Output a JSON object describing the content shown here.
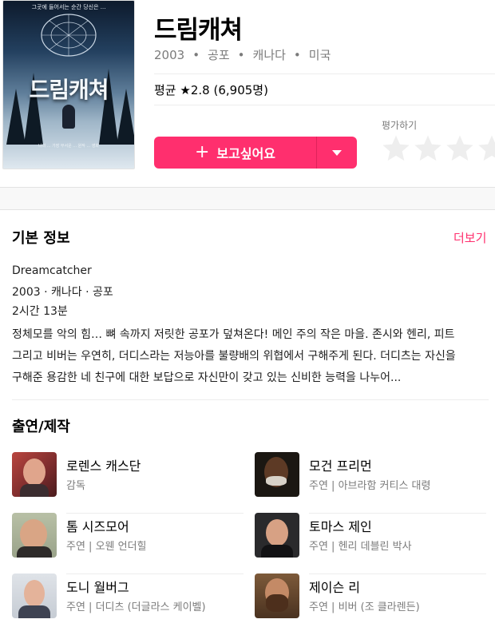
{
  "poster": {
    "tagline": "그곳에 들어서는 순간 당신은 ...",
    "title": "드림캐쳐",
    "credits": "나의 ... 가장 무서운 ... 원작 ... 영화"
  },
  "movie": {
    "title": "드림캐쳐",
    "year": "2003",
    "genre": "공포",
    "country1": "캐나다",
    "country2": "미국",
    "rating_prefix": "평균",
    "rating_value": "★2.8",
    "rating_count": "(6,905명)"
  },
  "actions": {
    "wish_plus": "+",
    "wish_label": "보고싶어요",
    "rate_label": "평가하기",
    "star_count": 4
  },
  "colors": {
    "accent": "#ff2f6e",
    "star_empty": "#eeeeee",
    "muted": "#7b7b7b"
  },
  "info": {
    "section_title": "기본 정보",
    "more_label": "더보기",
    "original_title": "Dreamcatcher",
    "summary_line": "2003 · 캐나다 · 공포",
    "runtime": "2시간 13분",
    "synopsis": "정체모를 악의 힘…  뼈 속까지 저릿한 공포가 덮쳐온다!  메인 주의 작은 마을. 존시와 헨리, 피트 그리고 비버는 우연히, 더디스라는 저능아를 불량배의 위협에서 구해주게 된다. 더디츠는 자신을 구해준 용감한 네 친구에 대한 보답으로 자신만이 갖고 있는 신비한 능력을 나누어..."
  },
  "cast": {
    "section_title": "출연/제작",
    "people": [
      {
        "name": "로렌스 캐스단",
        "role": "감독"
      },
      {
        "name": "모건 프리먼",
        "role": "주연 | 아브라함 커티스 대령"
      },
      {
        "name": "톰 시즈모어",
        "role": "주연 | 오웬 언더힐"
      },
      {
        "name": "토마스 제인",
        "role": "주연 | 헨리 데블린 박사"
      },
      {
        "name": "도니 월버그",
        "role": "주연 | 더디츠 (더글라스 케이벨)"
      },
      {
        "name": "제이슨 리",
        "role": "주연 | 비버 (조 클라렌든)"
      }
    ]
  }
}
